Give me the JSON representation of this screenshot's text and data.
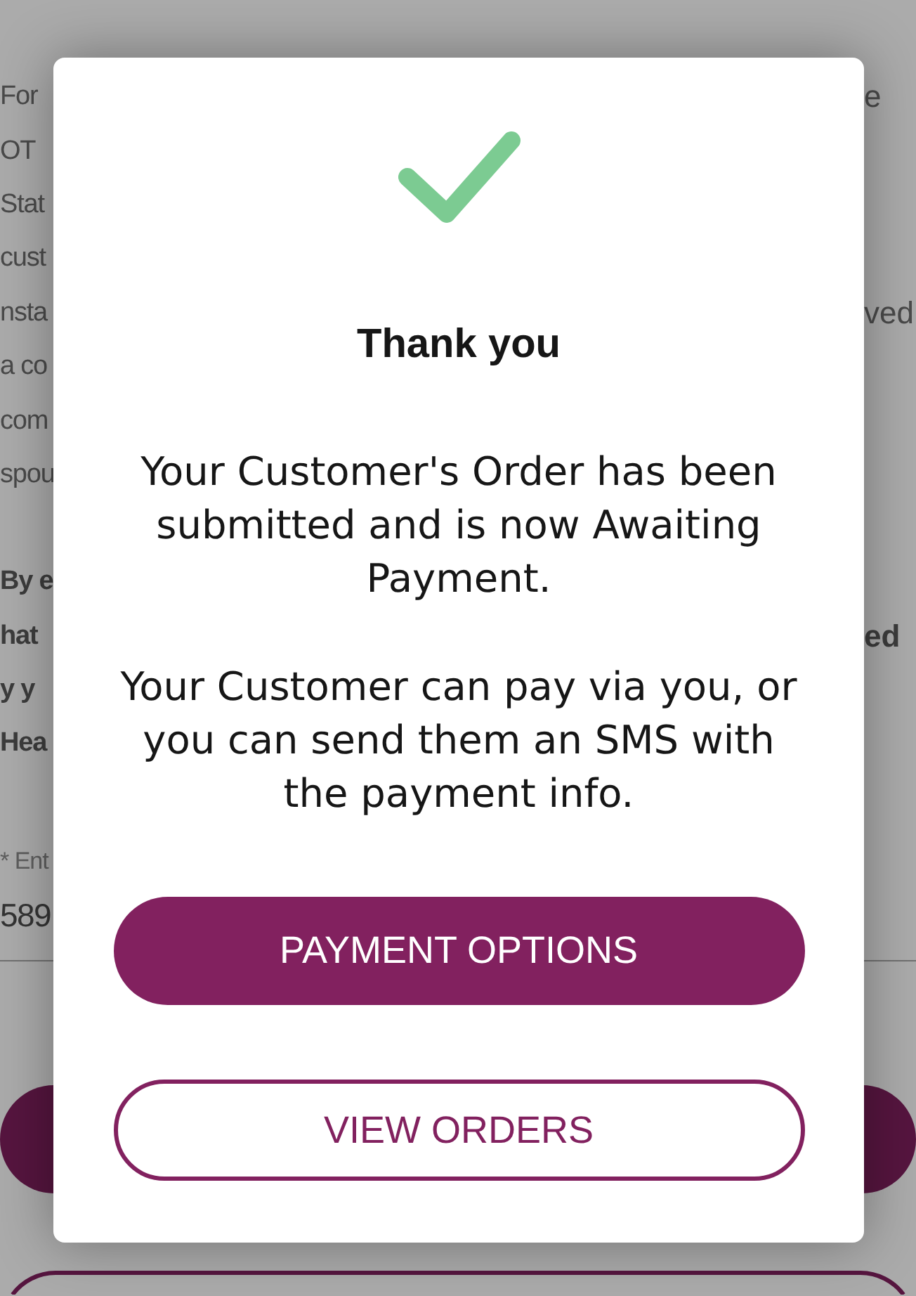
{
  "background": {
    "paragraphs": [
      {
        "kind": "plain",
        "lines": [
          {
            "left": "For",
            "right": "e"
          },
          {
            "left": "OT"
          },
          {
            "left": "Stat"
          },
          {
            "left": "cust"
          },
          {
            "left": "nsta",
            "right": "ved"
          },
          {
            "left": "a co"
          },
          {
            "left": "com"
          },
          {
            "left": "spou"
          }
        ]
      },
      {
        "kind": "bold",
        "lines": [
          {
            "left": "By e"
          },
          {
            "left": "hat",
            "right": "ed"
          },
          {
            "left": "y y"
          },
          {
            "left": "Hea"
          }
        ]
      }
    ],
    "field": {
      "label": "* Ent",
      "value": "589"
    },
    "buttons": [
      {
        "kind": "filled"
      },
      {
        "kind": "outlined"
      }
    ]
  },
  "dialog": {
    "title": "Thank you",
    "paragraphs": [
      "Your Customer's Order has been submitted and is now Awaiting Payment.",
      "Your Customer can pay via you, or you can send them an SMS with the payment info."
    ],
    "buttons": [
      {
        "label": "PAYMENT OPTIONS",
        "kind": "primary"
      },
      {
        "label": "VIEW ORDERS",
        "kind": "secondary"
      }
    ]
  }
}
